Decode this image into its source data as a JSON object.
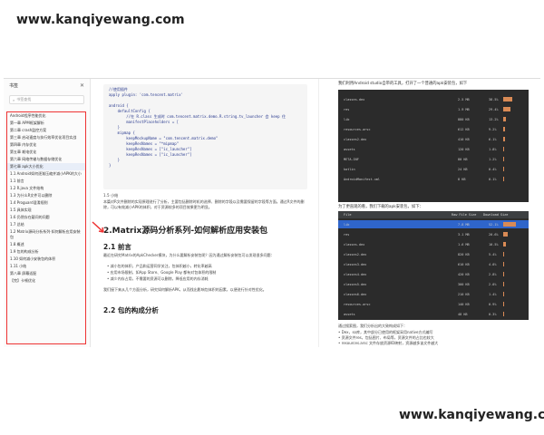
{
  "watermark": {
    "top": "www.kanqiyewang.com",
    "bottom": "www.kanqiyewang.com"
  },
  "sidebar": {
    "title": "书签",
    "search_placeholder": "书签查找",
    "items": [
      "Android程序性能优化",
      "第一章 APM框架解析",
      "第二章 crash监控方案",
      "第三章 启动速度与执行效率优化项目实战",
      "第四章 内存优化",
      "第五章 耗电优化",
      "第六章 网络传输与数据存储优化",
      "第七章 apk大小优化",
      "1.1 Android如何逐渐压缩并减小APK的大小",
      "1.1 前言",
      "1.2 R.java 文件结构",
      "1.3 为什么R文件可以删除",
      "1.4 Proguard混淆规则",
      "1.5 具体实现",
      "1.6 仍然存在疑问的问题",
      "1.7 总结",
      "1.2 Matrix源码分析系列-如何解析应用安装包",
      "1.8 概述",
      "1.9 包的构成分析",
      "1.10 如何减小安装包的体积",
      "1.11 小结",
      "第八章 屏幕适配",
      "【完】卡顿优化"
    ]
  },
  "doc": {
    "code_lines": [
      "//使用插件",
      "apply plugin: 'com.tencent.matrix'",
      "",
      "android {",
      "    defaultConfig {",
      "        //在 R.class 生成时 com.tencent.matrix.demo.R.string.tv_launcher 会 keep 住",
      "        manifestPlaceholders = [",
      "    }",
      "    mipmap {",
      "        keepMockupName = \"com.tencent.matrix.demo\"",
      "        keepResNames = \"*mipmap\"",
      "        keepResNames = [\"ic_launcher\"]",
      "        keepResNames = [\"ic_launcher\"]",
      "    }",
      "}"
    ],
    "summary_label": "1.5 小结",
    "summary_text": "本篇对R文件删除的实现原理进行了分析，主要包括删除时机的选择、删除的字段以及需要保留的字段等方面。通过R文件的删除，可以有效减小APK的体积，对于资源较多的项目效果更为明显。",
    "title": "2.Matrix源码分析系列-如何解析应用安装包",
    "sec1": "2.1 前言",
    "intro": "最近在研究Matrix的ApkChecker模块，为什么要解析安装包呢？因为通过解析安装包可以发现很多问题：",
    "bullets": [
      "减小包的体积，产品和运营同学关注，包体积越小，转化率越高",
      "应用市场限制，如App Store、Google Play 都有对包体积的限制",
      "减少内存占用，不需要的资源可以删除，降低应用的内存消耗"
    ],
    "para2": "我们接下来从几个方面分析，研究如何解析APK，从而找出影响包体积的因素，以便进行针对性优化。",
    "sec2": "2.2 包的构成分析"
  },
  "right": {
    "cap1": "我们利用Android studio自带的工具，打开了一个普通的apk安装包，如下",
    "shot1_rows": [
      {
        "name": "classes.dex",
        "v1": "2.5 MB",
        "v2": "38.5%"
      },
      {
        "name": "res",
        "v1": "1.9 MB",
        "v2": "29.4%"
      },
      {
        "name": "lib",
        "v1": "880 KB",
        "v2": "13.2%"
      },
      {
        "name": "resources.arsc",
        "v1": "612 KB",
        "v2": "9.2%"
      },
      {
        "name": "classes2.dex",
        "v1": "410 KB",
        "v2": "6.1%"
      },
      {
        "name": "assets",
        "v1": "120 KB",
        "v2": "1.8%"
      },
      {
        "name": "META-INF",
        "v1": "80 KB",
        "v2": "1.2%"
      },
      {
        "name": "kotlin",
        "v1": "24 KB",
        "v2": "0.4%"
      },
      {
        "name": "AndroidManifest.xml",
        "v1": "8 KB",
        "v2": "0.1%"
      }
    ],
    "cap2": "为了更直观的看，我们下载的apk安装包，如下：",
    "shot2_header": {
      "file": "File",
      "raw": "Raw File Size",
      "dl": "Download Size"
    },
    "shot2_rows": [
      {
        "name": "lib",
        "v1": "7.8 MB",
        "v2": "52.1%"
      },
      {
        "name": "res",
        "v1": "3.1 MB",
        "v2": "20.6%"
      },
      {
        "name": "classes.dex",
        "v1": "1.6 MB",
        "v2": "10.5%"
      },
      {
        "name": "classes2.dex",
        "v1": "820 KB",
        "v2": "5.4%"
      },
      {
        "name": "classes3.dex",
        "v1": "610 KB",
        "v2": "4.0%"
      },
      {
        "name": "classes4.dex",
        "v1": "420 KB",
        "v2": "2.8%"
      },
      {
        "name": "classes5.dex",
        "v1": "300 KB",
        "v2": "2.0%"
      },
      {
        "name": "classes6.dex",
        "v1": "210 KB",
        "v2": "1.4%"
      },
      {
        "name": "resources.arsc",
        "v1": "140 KB",
        "v2": "0.9%"
      },
      {
        "name": "assets",
        "v1": "48 KB",
        "v2": "0.3%"
      }
    ],
    "bottom_text": "通过搜索图，我们分析出的大致构成如下：",
    "bottom_bullets": [
      "Dex，so库，其中部分已使用的框架采用native方式编写",
      "资源文件res，包括图片、布局等，资源文件的占比也较大",
      "resources.arsc 文件存放资源ID映射，资源越多该文件越大"
    ]
  }
}
